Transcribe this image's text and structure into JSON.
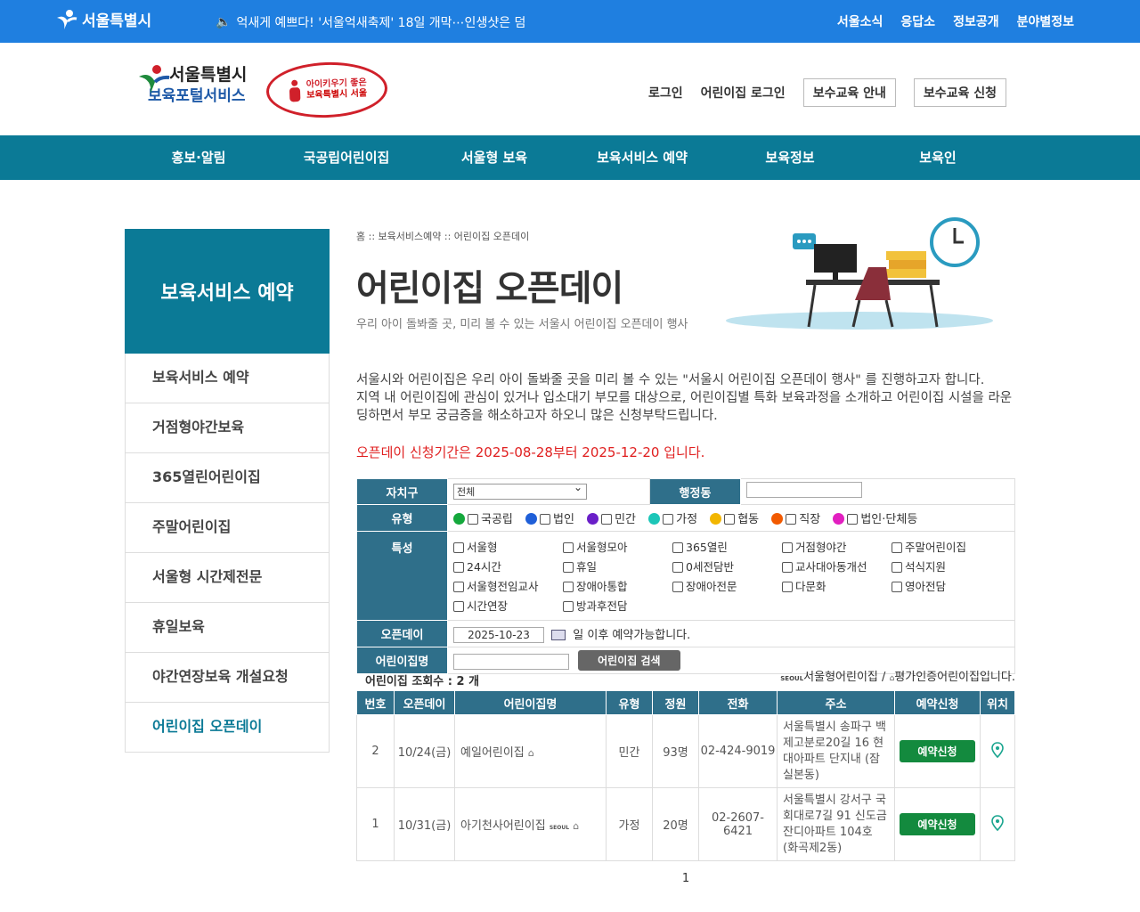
{
  "topbar": {
    "logo": "서울특별시",
    "news": "억새게 예쁘다! '서울억새축제' 18일 개막⋯인생샷은 덤",
    "links": [
      "서울소식",
      "응답소",
      "정보공개",
      "분야별정보"
    ]
  },
  "header": {
    "brand_line1": "서울특별시",
    "brand_line2": "보육포털서비스",
    "badge_line1": "아이키우기 좋은",
    "badge_line2": "보육특별시 서울",
    "login": "로그인",
    "center_login": "어린이집 로그인",
    "edu_info": "보수교육 안내",
    "edu_apply": "보수교육 신청"
  },
  "nav": [
    "홍보·알림",
    "국공립어린이집",
    "서울형 보육",
    "보육서비스 예약",
    "보육정보",
    "보육인"
  ],
  "sidebar": {
    "title": "보육서비스 예약",
    "items": [
      "보육서비스 예약",
      "거점형야간보육",
      "365열린어린이집",
      "주말어린이집",
      "서울형 시간제전문",
      "휴일보육",
      "야간연장보육 개설요청",
      "어린이집 오픈데이"
    ]
  },
  "main": {
    "breadcrumb": "홈 :: 보육서비스예약 :: 어린이집 오픈데이",
    "title": "어린이집 오픈데이",
    "subtitle": "우리 아이 돌봐줄 곳, 미리 볼 수 있는 서울시 어린이집 오픈데이 행사",
    "intro1": "서울시와 어린이집은 우리 아이 돌봐줄 곳을 미리 볼 수 있는 \"서울시 어린이집 오픈데이 행사\" 를 진행하고자 합니다.",
    "intro2": "지역 내 어린이집에 관심이 있거나 입소대기 부모를 대상으로, 어린이집별 특화 보육과정을 소개하고 어린이집 시설을 라운딩하면서 부모 궁금증을 해소하고자 하오니 많은 신청부탁드립니다.",
    "period": "오픈데이 신청기간은 2025-08-28부터 2025-12-20 입니다."
  },
  "search": {
    "district_label": "자치구",
    "district_value": "전체",
    "dong_label": "행정동",
    "type_label": "유형",
    "types": [
      {
        "name": "국공립",
        "color": "#14a83c"
      },
      {
        "name": "법인",
        "color": "#1f5fd8"
      },
      {
        "name": "민간",
        "color": "#6a1fc8"
      },
      {
        "name": "가정",
        "color": "#1cc6b8"
      },
      {
        "name": "협동",
        "color": "#f2b600"
      },
      {
        "name": "직장",
        "color": "#f25a00"
      },
      {
        "name": "법인·단체등",
        "color": "#e21fc0"
      }
    ],
    "feature_label": "특성",
    "features": [
      "서울형",
      "서울형모아",
      "365열린",
      "거점형야간",
      "주말어린이집",
      "24시간",
      "휴일",
      "0세전담반",
      "교사대아동개선",
      "석식지원",
      "서울형전임교사",
      "장애아통합",
      "장애아전문",
      "다문화",
      "영아전담",
      "시간연장",
      "방과후전담"
    ],
    "openday_label": "오픈데이",
    "date_value": "2025-10-23",
    "date_note": "일 이후 예약가능합니다.",
    "name_label": "어린이집명",
    "search_button": "어린이집 검색"
  },
  "results": {
    "count": "어린이집 조회수 : 2 개",
    "legend_seoul": "서울형어린이집",
    "legend_sep": "/",
    "legend_cert": "평가인증어린이집입니다.",
    "headers": [
      "번호",
      "오픈데이",
      "어린이집명",
      "유형",
      "정원",
      "전화",
      "주소",
      "예약신청",
      "위치"
    ],
    "rows": [
      {
        "no": "2",
        "date": "10/24(금)",
        "name": "예일어린이집",
        "type": "민간",
        "capacity": "93명",
        "phone": "02-424-9019",
        "address": "서울특별시 송파구 백제고분로20길 16 현대아파트 단지내 (잠실본동)",
        "reserve": "예약신청"
      },
      {
        "no": "1",
        "date": "10/31(금)",
        "name": "아기천사어린이집",
        "type": "가정",
        "capacity": "20명",
        "phone": "02-2607-6421",
        "address": "서울특별시 강서구 국회대로7길 91 신도금잔디아파트 104호 (화곡제2동)",
        "reserve": "예약신청"
      }
    ],
    "page": "1"
  }
}
